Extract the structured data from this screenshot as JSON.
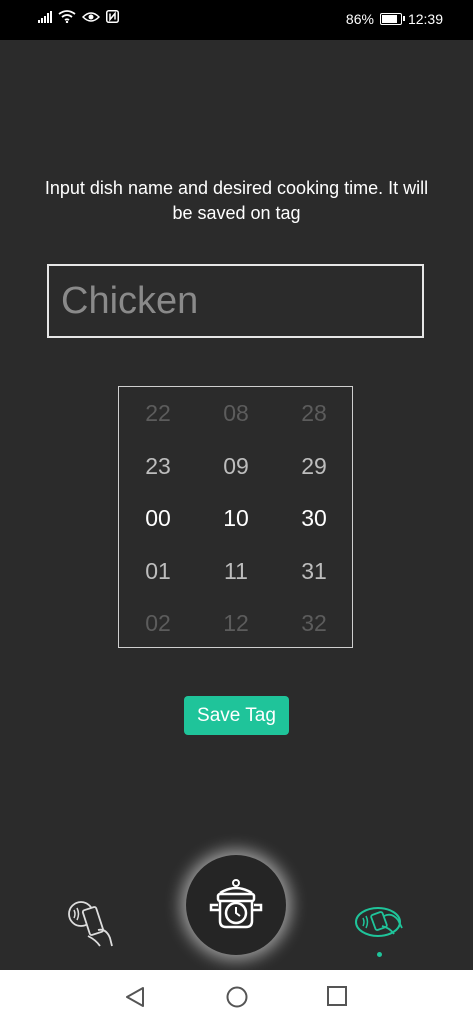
{
  "status_bar": {
    "battery_text": "86%",
    "battery_level": 0.86,
    "time": "12:39",
    "icons": [
      "signal-icon",
      "wifi-icon",
      "eye-icon",
      "nfc-icon",
      "battery-icon"
    ]
  },
  "instruction": "Input dish name and desired cooking time. It will be saved on tag",
  "dish_input": {
    "value": "",
    "placeholder": "Chicken"
  },
  "time_picker": {
    "columns": [
      {
        "name": "hours",
        "values": [
          "22",
          "23",
          "00",
          "01",
          "02"
        ],
        "selected": "00"
      },
      {
        "name": "minutes",
        "values": [
          "08",
          "09",
          "10",
          "11",
          "12"
        ],
        "selected": "10"
      },
      {
        "name": "seconds",
        "values": [
          "28",
          "29",
          "30",
          "31",
          "32"
        ],
        "selected": "30"
      }
    ]
  },
  "save_button": "Save Tag",
  "bottom_nav": {
    "items": [
      {
        "icon": "phone-nfc-icon",
        "active": false
      },
      {
        "icon": "cooking-pot-timer-icon",
        "active": false
      },
      {
        "icon": "write-tag-icon",
        "active": true
      }
    ],
    "accent_color": "#1fc49a"
  },
  "system_nav": {
    "icons": [
      "back-icon",
      "home-icon",
      "recents-icon"
    ]
  }
}
